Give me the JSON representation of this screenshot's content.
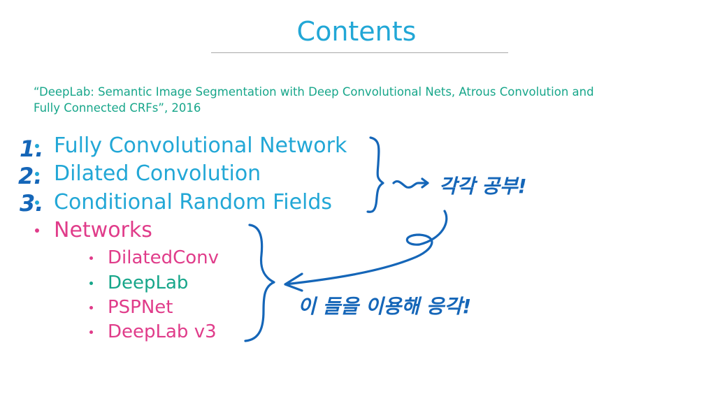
{
  "slide": {
    "title": "Contents",
    "citation_line1": "“DeepLab: Semantic Image Segmentation with Deep Convolutional Nets, Atrous Convolution and",
    "citation_line2": "Fully Connected CRFs”, 2016",
    "topics": [
      {
        "label": "Fully Convolutional Network",
        "color": "#22a7d6"
      },
      {
        "label": "Dilated Convolution",
        "color": "#22a7d6"
      },
      {
        "label": "Conditional Random Fields",
        "color": "#22a7d6"
      },
      {
        "label": "Networks",
        "color": "#e03c8a"
      }
    ],
    "networks": [
      {
        "label": "DilatedConv",
        "color": "#e03c8a"
      },
      {
        "label": "DeepLab",
        "color": "#17a68a"
      },
      {
        "label": "PSPNet",
        "color": "#e03c8a"
      },
      {
        "label": "DeepLab v3",
        "color": "#e03c8a"
      }
    ]
  },
  "annotations": {
    "ink_color": "#1566b8",
    "numbers": [
      "1.",
      "2.",
      "3."
    ],
    "note_top": "각각 공부!",
    "note_bottom": "이 들을 이용해 응각!"
  }
}
